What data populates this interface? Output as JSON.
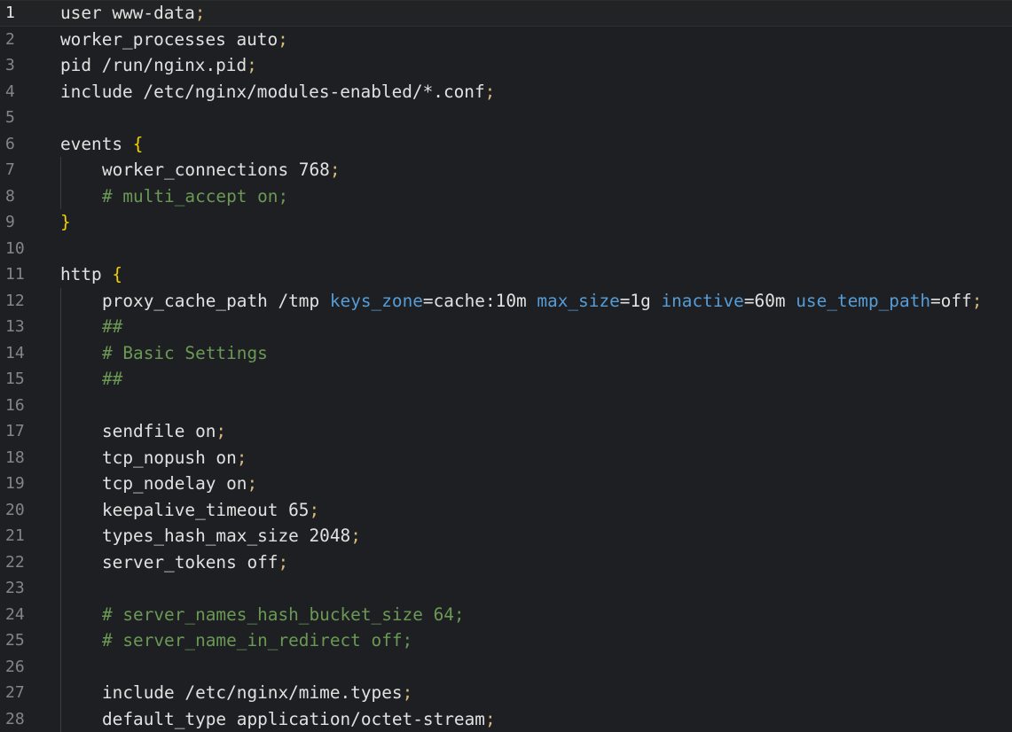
{
  "editor": {
    "current_line": 1,
    "colors": {
      "background": "#1e1f22",
      "text": "#e1e1e1",
      "semicolon": "#d7ba7d",
      "brace": "#f0d000",
      "comment": "#6a9955",
      "parameter": "#569cd6",
      "line_number": "#858585"
    },
    "lines": [
      {
        "n": "1",
        "indent": 0,
        "tokens": [
          {
            "t": "user www-data",
            "k": "plain"
          },
          {
            "t": ";",
            "k": "punct"
          }
        ]
      },
      {
        "n": "2",
        "indent": 0,
        "tokens": [
          {
            "t": "worker_processes auto",
            "k": "plain"
          },
          {
            "t": ";",
            "k": "punct"
          }
        ]
      },
      {
        "n": "3",
        "indent": 0,
        "tokens": [
          {
            "t": "pid /run/nginx.pid",
            "k": "plain"
          },
          {
            "t": ";",
            "k": "punct"
          }
        ]
      },
      {
        "n": "4",
        "indent": 0,
        "tokens": [
          {
            "t": "include /etc/nginx/modules-enabled/*.conf",
            "k": "plain"
          },
          {
            "t": ";",
            "k": "punct"
          }
        ]
      },
      {
        "n": "5",
        "indent": 0,
        "tokens": []
      },
      {
        "n": "6",
        "indent": 0,
        "tokens": [
          {
            "t": "events ",
            "k": "plain"
          },
          {
            "t": "{",
            "k": "brace"
          }
        ]
      },
      {
        "n": "7",
        "indent": 1,
        "tokens": [
          {
            "t": "worker_connections 768",
            "k": "plain"
          },
          {
            "t": ";",
            "k": "punct"
          }
        ]
      },
      {
        "n": "8",
        "indent": 1,
        "tokens": [
          {
            "t": "# multi_accept on;",
            "k": "comment"
          }
        ]
      },
      {
        "n": "9",
        "indent": 0,
        "tokens": [
          {
            "t": "}",
            "k": "brace"
          }
        ]
      },
      {
        "n": "10",
        "indent": 0,
        "tokens": []
      },
      {
        "n": "11",
        "indent": 0,
        "tokens": [
          {
            "t": "http ",
            "k": "plain"
          },
          {
            "t": "{",
            "k": "brace"
          }
        ]
      },
      {
        "n": "12",
        "indent": 1,
        "tokens": [
          {
            "t": "proxy_cache_path /tmp ",
            "k": "plain"
          },
          {
            "t": "keys_zone",
            "k": "param"
          },
          {
            "t": "=cache:10m ",
            "k": "plain"
          },
          {
            "t": "max_size",
            "k": "param"
          },
          {
            "t": "=1g ",
            "k": "plain"
          },
          {
            "t": "inactive",
            "k": "param"
          },
          {
            "t": "=60m ",
            "k": "plain"
          },
          {
            "t": "use_temp_path",
            "k": "param"
          },
          {
            "t": "=off",
            "k": "plain"
          },
          {
            "t": ";",
            "k": "punct"
          }
        ]
      },
      {
        "n": "13",
        "indent": 1,
        "tokens": [
          {
            "t": "##",
            "k": "comment"
          }
        ]
      },
      {
        "n": "14",
        "indent": 1,
        "tokens": [
          {
            "t": "# Basic Settings",
            "k": "comment"
          }
        ]
      },
      {
        "n": "15",
        "indent": 1,
        "tokens": [
          {
            "t": "##",
            "k": "comment"
          }
        ]
      },
      {
        "n": "16",
        "indent": 1,
        "tokens": []
      },
      {
        "n": "17",
        "indent": 1,
        "tokens": [
          {
            "t": "sendfile on",
            "k": "plain"
          },
          {
            "t": ";",
            "k": "punct"
          }
        ]
      },
      {
        "n": "18",
        "indent": 1,
        "tokens": [
          {
            "t": "tcp_nopush on",
            "k": "plain"
          },
          {
            "t": ";",
            "k": "punct"
          }
        ]
      },
      {
        "n": "19",
        "indent": 1,
        "tokens": [
          {
            "t": "tcp_nodelay on",
            "k": "plain"
          },
          {
            "t": ";",
            "k": "punct"
          }
        ]
      },
      {
        "n": "20",
        "indent": 1,
        "tokens": [
          {
            "t": "keepalive_timeout 65",
            "k": "plain"
          },
          {
            "t": ";",
            "k": "punct"
          }
        ]
      },
      {
        "n": "21",
        "indent": 1,
        "tokens": [
          {
            "t": "types_hash_max_size 2048",
            "k": "plain"
          },
          {
            "t": ";",
            "k": "punct"
          }
        ]
      },
      {
        "n": "22",
        "indent": 1,
        "tokens": [
          {
            "t": "server_tokens off",
            "k": "plain"
          },
          {
            "t": ";",
            "k": "punct"
          }
        ]
      },
      {
        "n": "23",
        "indent": 1,
        "tokens": []
      },
      {
        "n": "24",
        "indent": 1,
        "tokens": [
          {
            "t": "# server_names_hash_bucket_size 64;",
            "k": "comment"
          }
        ]
      },
      {
        "n": "25",
        "indent": 1,
        "tokens": [
          {
            "t": "# server_name_in_redirect off;",
            "k": "comment"
          }
        ]
      },
      {
        "n": "26",
        "indent": 1,
        "tokens": []
      },
      {
        "n": "27",
        "indent": 1,
        "tokens": [
          {
            "t": "include /etc/nginx/mime.types",
            "k": "plain"
          },
          {
            "t": ";",
            "k": "punct"
          }
        ]
      },
      {
        "n": "28",
        "indent": 1,
        "tokens": [
          {
            "t": "default_type application/octet-stream",
            "k": "plain"
          },
          {
            "t": ";",
            "k": "punct"
          }
        ]
      }
    ]
  }
}
